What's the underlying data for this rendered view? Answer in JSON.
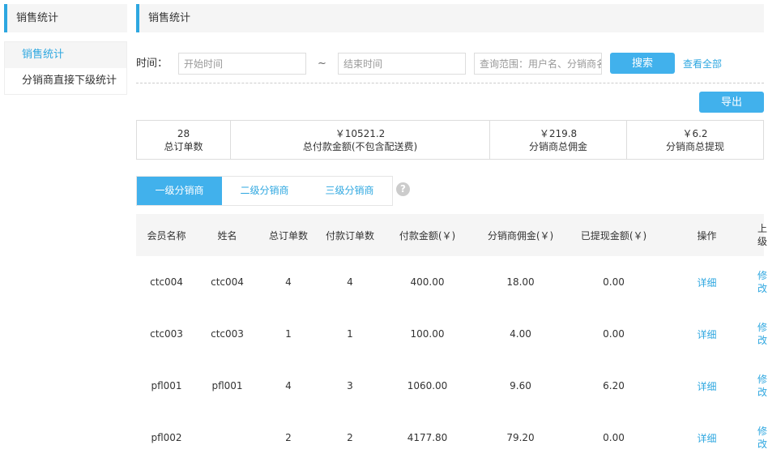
{
  "sidebar": {
    "title": "销售统计",
    "items": [
      {
        "label": "销售统计",
        "active": true
      },
      {
        "label": "分销商直接下级统计",
        "active": false
      }
    ]
  },
  "main": {
    "title": "销售统计",
    "search": {
      "time_label": "时间：",
      "start_placeholder": "开始时间",
      "tilde": "~",
      "end_placeholder": "结束时间",
      "range_placeholder": "查询范围：用户名、分销商名",
      "search_button": "搜索",
      "view_all": "查看全部"
    },
    "export_button": "导出",
    "stats": [
      {
        "value": "28",
        "label": "总订单数"
      },
      {
        "value": "￥10521.2",
        "label": "总付款金额(不包含配送费)"
      },
      {
        "value": "￥219.8",
        "label": "分销商总佣金"
      },
      {
        "value": "￥6.2",
        "label": "分销商总提现"
      }
    ],
    "tabs": [
      {
        "label": "一级分销商",
        "active": true
      },
      {
        "label": "二级分销商",
        "active": false
      },
      {
        "label": "三级分销商",
        "active": false
      }
    ],
    "help_icon": "?",
    "table": {
      "headers": [
        "会员名称",
        "姓名",
        "总订单数",
        "付款订单数",
        "付款金额(￥)",
        "分销商佣金(￥)",
        "已提现金额(￥)",
        "操作",
        "上级"
      ],
      "rows": [
        {
          "member": "ctc004",
          "name": "ctc004",
          "total_orders": "4",
          "paid_orders": "4",
          "paid_amount": "400.00",
          "commission": "18.00",
          "withdrawn": "0.00",
          "action": "详细",
          "parent": "修改"
        },
        {
          "member": "ctc003",
          "name": "ctc003",
          "total_orders": "1",
          "paid_orders": "1",
          "paid_amount": "100.00",
          "commission": "4.00",
          "withdrawn": "0.00",
          "action": "详细",
          "parent": "修改"
        },
        {
          "member": "pfl001",
          "name": "pfl001",
          "total_orders": "4",
          "paid_orders": "3",
          "paid_amount": "1060.00",
          "commission": "9.60",
          "withdrawn": "6.20",
          "action": "详细",
          "parent": "修改"
        },
        {
          "member": "pfl002",
          "name": "",
          "total_orders": "2",
          "paid_orders": "2",
          "paid_amount": "4177.80",
          "commission": "79.20",
          "withdrawn": "0.00",
          "action": "详细",
          "parent": "修改"
        }
      ]
    }
  }
}
